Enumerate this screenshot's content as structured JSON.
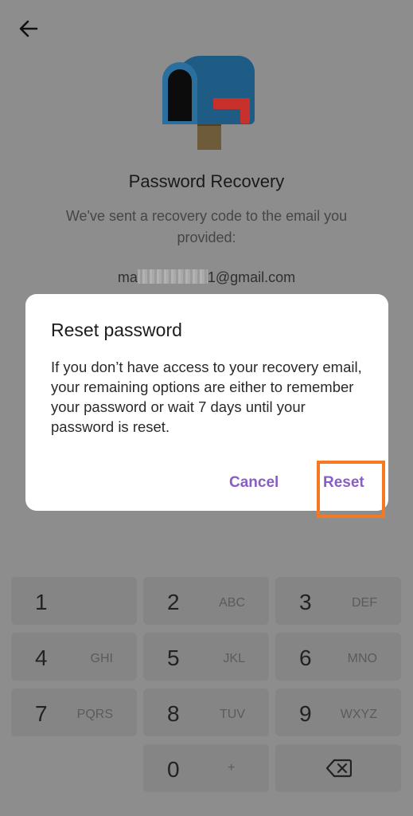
{
  "header": {
    "back_icon": "arrow-left-icon"
  },
  "hero": {
    "icon": "mailbox-icon"
  },
  "recovery": {
    "title": "Password Recovery",
    "subtitle": "We've sent a recovery code to the email you provided:",
    "email_prefix": "ma",
    "email_suffix": "1@gmail.com"
  },
  "dialog": {
    "title": "Reset password",
    "body": "If you don’t have access to your recovery email, your remaining options are either to remember your password or wait 7 days until your password is reset.",
    "cancel_label": "Cancel",
    "reset_label": "Reset"
  },
  "keypad": {
    "keys": [
      {
        "num": "1",
        "letters": ""
      },
      {
        "num": "2",
        "letters": "ABC"
      },
      {
        "num": "3",
        "letters": "DEF"
      },
      {
        "num": "4",
        "letters": "GHI"
      },
      {
        "num": "5",
        "letters": "JKL"
      },
      {
        "num": "6",
        "letters": "MNO"
      },
      {
        "num": "7",
        "letters": "PQRS"
      },
      {
        "num": "8",
        "letters": "TUV"
      },
      {
        "num": "9",
        "letters": "WXYZ"
      },
      {
        "num": "0",
        "letters": "+"
      }
    ],
    "backspace_icon": "backspace-icon"
  },
  "colors": {
    "accent": "#8a5dc6",
    "highlight": "#f57921"
  }
}
